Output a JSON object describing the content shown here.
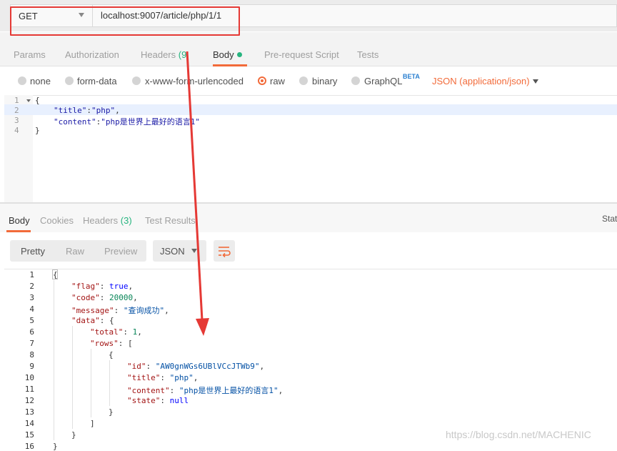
{
  "request": {
    "method": "GET",
    "url": "localhost:9007/article/php/1/1"
  },
  "request_tabs": {
    "params": "Params",
    "authorization": "Authorization",
    "headers_label": "Headers",
    "headers_count": "(9",
    "body": "Body",
    "pre_request": "Pre-request Script",
    "tests": "Tests"
  },
  "body_types": {
    "none": "none",
    "form_data": "form-data",
    "urlencoded": "x-www-form-urlencoded",
    "raw": "raw",
    "binary": "binary",
    "graphql": "GraphQL",
    "beta": "BETA",
    "content_type": "JSON (application/json)"
  },
  "request_body": {
    "line_numbers": [
      "1",
      "2",
      "3",
      "4"
    ],
    "l1": "{",
    "l2_key": "\"title\"",
    "l2_sep": ":",
    "l2_val": "\"php\"",
    "l2_end": ",",
    "l3_key": "\"content\"",
    "l3_sep": ":",
    "l3_val": "\"php是世界上最好的语言1\"",
    "l4": "}"
  },
  "response_tabs": {
    "body": "Body",
    "cookies": "Cookies",
    "headers_label": "Headers",
    "headers_count": "(3)",
    "test_results": "Test Results",
    "status": "Statu"
  },
  "response_toolbar": {
    "pretty": "Pretty",
    "raw": "Raw",
    "preview": "Preview",
    "format": "JSON"
  },
  "response_body": {
    "line_numbers": [
      "1",
      "2",
      "3",
      "4",
      "5",
      "6",
      "7",
      "8",
      "9",
      "10",
      "11",
      "12",
      "13",
      "14",
      "15",
      "16"
    ],
    "l1": "{",
    "flag_key": "\"flag\"",
    "flag_val": "true",
    "code_key": "\"code\"",
    "code_val": "20000",
    "message_key": "\"message\"",
    "message_val": "\"查询成功\"",
    "data_key": "\"data\"",
    "total_key": "\"total\"",
    "total_val": "1",
    "rows_key": "\"rows\"",
    "id_key": "\"id\"",
    "id_val": "\"AW0gnWGs6UBlVCcJTWb9\"",
    "title_key": "\"title\"",
    "title_val": "\"php\"",
    "content_key": "\"content\"",
    "content_val": "\"php是世界上最好的语言1\"",
    "state_key": "\"state\"",
    "state_val": "null"
  },
  "watermark": "https://blog.csdn.net/MACHENIC",
  "colors": {
    "accent": "#f26b3a",
    "green": "#26b47f",
    "annotation_red": "#e53935"
  }
}
